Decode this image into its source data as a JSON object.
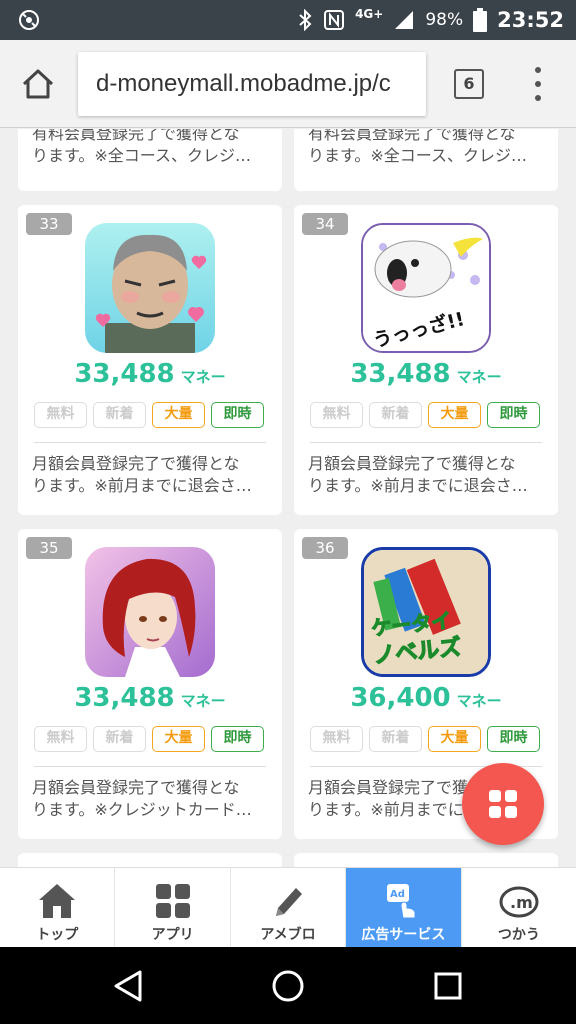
{
  "status_bar": {
    "network": "4G+",
    "battery": "98%",
    "time": "23:52"
  },
  "browser": {
    "url": "d-moneymall.mobadme.jp/c",
    "tab_count": "6"
  },
  "top_cards": [
    {
      "desc_line1": "有料会員登録完了で獲得とな",
      "desc_line2": "ります。※全コース、クレジ…"
    },
    {
      "desc_line1": "有料会員登録完了で獲得とな",
      "desc_line2": "ります。※全コース、クレジ…"
    }
  ],
  "cards": [
    {
      "rank": "33",
      "amount": "33,488",
      "unit": "マネー",
      "tags": [
        "無料",
        "新着",
        "大量",
        "即時"
      ],
      "desc_line1": "月額会員登録完了で獲得とな",
      "desc_line2": "ります。※前月までに退会さ…"
    },
    {
      "rank": "34",
      "amount": "33,488",
      "unit": "マネー",
      "tags": [
        "無料",
        "新着",
        "大量",
        "即時"
      ],
      "desc_line1": "月額会員登録完了で獲得とな",
      "desc_line2": "ります。※前月までに退会さ…",
      "icon_text": "うっっざ!!"
    },
    {
      "rank": "35",
      "amount": "33,488",
      "unit": "マネー",
      "tags": [
        "無料",
        "新着",
        "大量",
        "即時"
      ],
      "desc_line1": "月額会員登録完了で獲得とな",
      "desc_line2": "ります。※クレジットカード…"
    },
    {
      "rank": "36",
      "amount": "36,400",
      "unit": "マネー",
      "tags": [
        "無料",
        "新着",
        "大量",
        "即時"
      ],
      "desc_line1": "月額会員登録完了で獲得とな",
      "desc_line2": "ります。※前月までに",
      "icon_text_1": "ケータイ",
      "icon_text_2": "ノベルズ"
    }
  ],
  "bottom_nav": [
    {
      "label": "トップ",
      "icon": "home-icon"
    },
    {
      "label": "アプリ",
      "icon": "apps-grid-icon"
    },
    {
      "label": "アメブロ",
      "icon": "pencil-icon"
    },
    {
      "label": "広告サービス",
      "icon": "ad-tap-icon",
      "active": true
    },
    {
      "label": "つかう",
      "icon": "money-icon"
    }
  ],
  "colors": {
    "accent_green": "#2cc199",
    "tag_orange": "#f39c12",
    "tag_green": "#2e9a3c",
    "fab_red": "#f4574f",
    "active_nav": "#4d9af5"
  }
}
